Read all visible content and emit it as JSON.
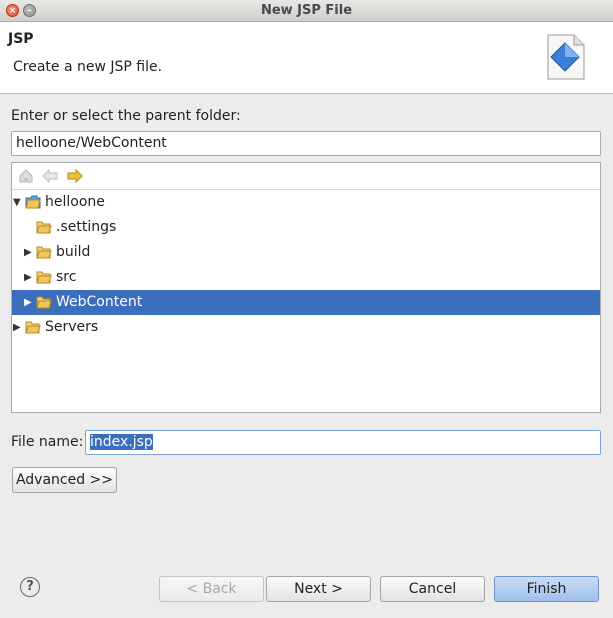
{
  "window": {
    "title": "New JSP File"
  },
  "banner": {
    "title": "JSP",
    "description": "Create a new JSP file."
  },
  "parent_folder": {
    "label": "Enter or select the parent folder:",
    "value": "helloone/WebContent"
  },
  "tree": {
    "items": [
      {
        "label": "helloone",
        "expanded": true,
        "type": "project"
      },
      {
        "label": ".settings",
        "expanded": false,
        "type": "folder"
      },
      {
        "label": "build",
        "expanded": false,
        "type": "folder"
      },
      {
        "label": "src",
        "expanded": false,
        "type": "folder"
      },
      {
        "label": "WebContent",
        "expanded": false,
        "type": "folder",
        "selected": true
      },
      {
        "label": "Servers",
        "expanded": false,
        "type": "folder"
      }
    ]
  },
  "file_name": {
    "label": "File name:",
    "value": "index.jsp"
  },
  "buttons": {
    "advanced": "Advanced >>",
    "back": "< Back",
    "next": "Next >",
    "cancel": "Cancel",
    "finish": "Finish"
  },
  "help": {
    "glyph": "?"
  },
  "colors": {
    "selection": "#3c6ebe",
    "folder": "#e8b33c"
  }
}
